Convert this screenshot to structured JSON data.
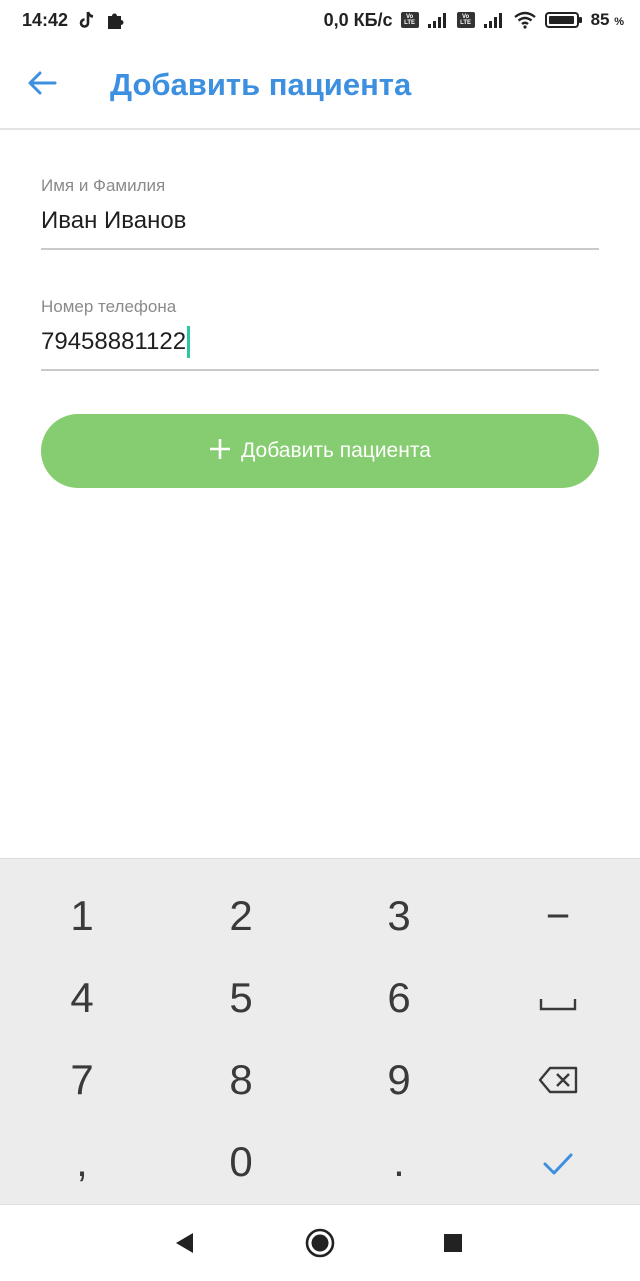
{
  "status_bar": {
    "time": "14:42",
    "network_speed": "0,0 КБ/с",
    "battery_percent": "85",
    "battery_unit": "%",
    "volte_line1": "Vo",
    "volte_line2": "LTE"
  },
  "app_bar": {
    "title": "Добавить пациента",
    "accent_color": "#3d8fe0"
  },
  "form": {
    "name_label": "Имя и Фамилия",
    "name_value": "Иван Иванов",
    "phone_label": "Номер телефона",
    "phone_value": "79458881122"
  },
  "add_button": {
    "label": "Добавить пациента",
    "color": "#86cc70"
  },
  "keyboard": {
    "keys": [
      "1",
      "2",
      "3",
      "−",
      "4",
      "5",
      "6",
      "7",
      "8",
      "9",
      ",",
      "0",
      "."
    ]
  }
}
